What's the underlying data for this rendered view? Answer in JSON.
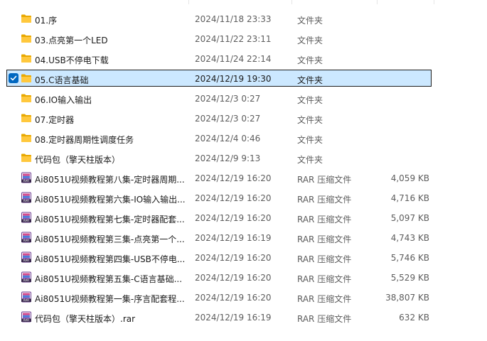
{
  "colors": {
    "selection_bg": "#cce8ff",
    "checkbox_accent": "#0067c0",
    "folder_yellow": "#ffc83d",
    "rar_purple": "#8a4fb3"
  },
  "files": [
    {
      "name": "01.序",
      "date": "2024/11/18 23:33",
      "type": "文件夹",
      "size": "",
      "icon": "folder-icon",
      "selected": false
    },
    {
      "name": "03.点亮第一个LED",
      "date": "2024/11/22 23:11",
      "type": "文件夹",
      "size": "",
      "icon": "folder-icon",
      "selected": false
    },
    {
      "name": "04.USB不停电下载",
      "date": "2024/11/24 22:14",
      "type": "文件夹",
      "size": "",
      "icon": "folder-icon",
      "selected": false
    },
    {
      "name": "05.C语言基础",
      "date": "2024/12/19 19:30",
      "type": "文件夹",
      "size": "",
      "icon": "folder-icon",
      "selected": true
    },
    {
      "name": "06.IO输入输出",
      "date": "2024/12/3 0:27",
      "type": "文件夹",
      "size": "",
      "icon": "folder-icon",
      "selected": false
    },
    {
      "name": "07.定时器",
      "date": "2024/12/3 0:27",
      "type": "文件夹",
      "size": "",
      "icon": "folder-icon",
      "selected": false
    },
    {
      "name": "08.定时器周期性调度任务",
      "date": "2024/12/4 0:46",
      "type": "文件夹",
      "size": "",
      "icon": "folder-icon",
      "selected": false
    },
    {
      "name": "代码包（擎天柱版本）",
      "date": "2024/12/9 9:13",
      "type": "文件夹",
      "size": "",
      "icon": "folder-icon",
      "selected": false
    },
    {
      "name": "Ai8051U视频教程第八集-定时器周期...",
      "date": "2024/12/19 16:20",
      "type": "RAR 压缩文件",
      "size": "4,059 KB",
      "icon": "rar-icon",
      "selected": false
    },
    {
      "name": "Ai8051U视频教程第六集-IO输入输出...",
      "date": "2024/12/19 16:20",
      "type": "RAR 压缩文件",
      "size": "4,716 KB",
      "icon": "rar-icon",
      "selected": false
    },
    {
      "name": "Ai8051U视频教程第七集-定时器配套...",
      "date": "2024/12/19 16:20",
      "type": "RAR 压缩文件",
      "size": "5,097 KB",
      "icon": "rar-icon",
      "selected": false
    },
    {
      "name": "Ai8051U视频教程第三集-点亮第一个...",
      "date": "2024/12/19 16:19",
      "type": "RAR 压缩文件",
      "size": "4,743 KB",
      "icon": "rar-icon",
      "selected": false
    },
    {
      "name": "Ai8051U视频教程第四集-USB不停电...",
      "date": "2024/12/19 16:20",
      "type": "RAR 压缩文件",
      "size": "5,746 KB",
      "icon": "rar-icon",
      "selected": false
    },
    {
      "name": "Ai8051U视频教程第五集-C语言基础...",
      "date": "2024/12/19 16:20",
      "type": "RAR 压缩文件",
      "size": "5,529 KB",
      "icon": "rar-icon",
      "selected": false
    },
    {
      "name": "Ai8051U视频教程第一集-序言配套程...",
      "date": "2024/12/19 16:20",
      "type": "RAR 压缩文件",
      "size": "38,807 KB",
      "icon": "rar-icon",
      "selected": false
    },
    {
      "name": "代码包（擎天柱版本）.rar",
      "date": "2024/12/19 16:19",
      "type": "RAR 压缩文件",
      "size": "632 KB",
      "icon": "rar-icon",
      "selected": false
    }
  ]
}
